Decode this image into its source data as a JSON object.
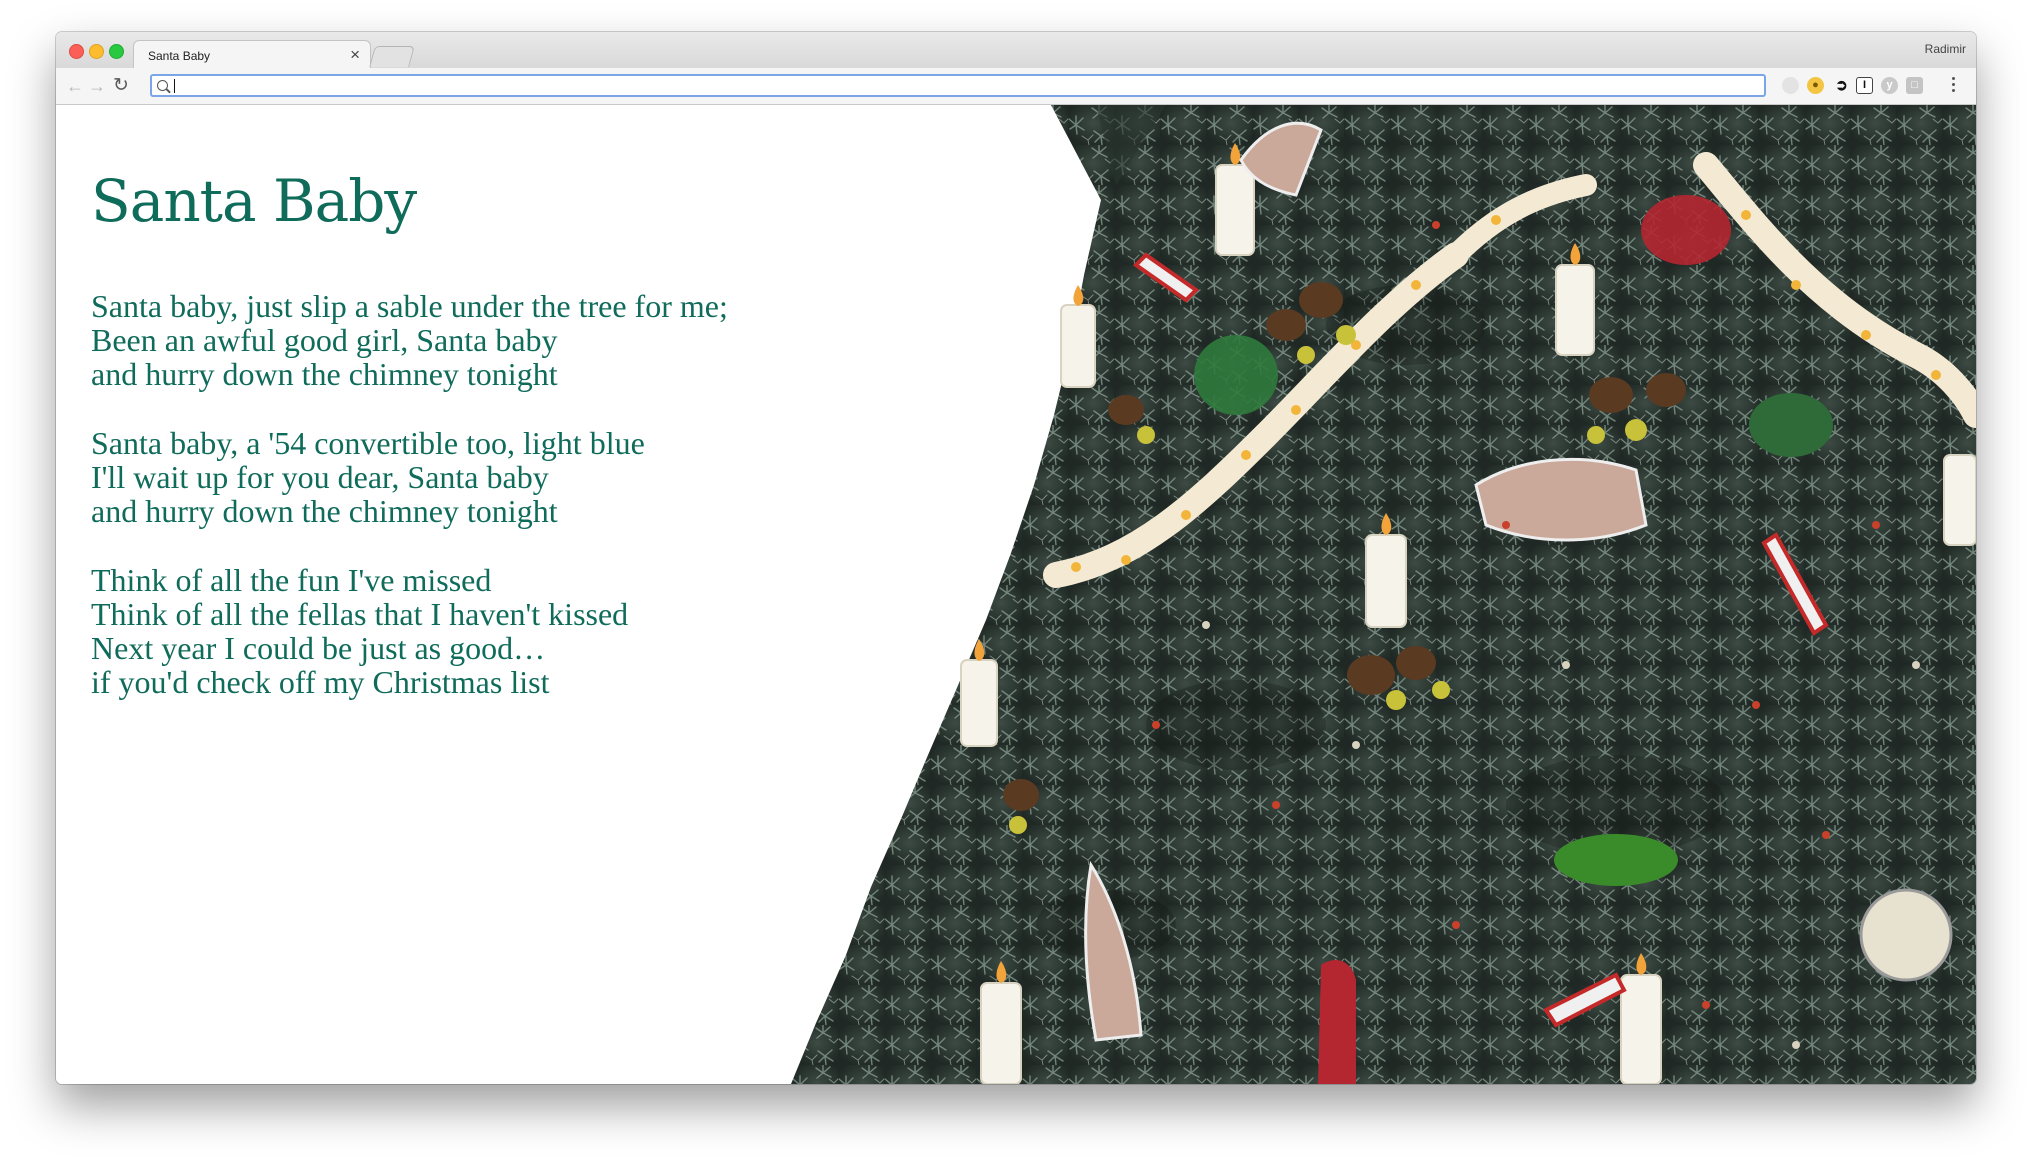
{
  "browser": {
    "tab_title": "Santa Baby",
    "tab_close": "×",
    "profile_name": "Radimir",
    "address_value": "",
    "icons": {
      "back": "back-arrow-icon",
      "forward": "forward-arrow-icon",
      "reload": "reload-icon",
      "search": "search-icon",
      "menu": "kebab-menu-icon"
    },
    "extensions": [
      "extension-circle-icon",
      "extension-coin-icon",
      "extension-cursor-icon",
      "extension-text-cursor-icon",
      "extension-y-icon",
      "extension-square-icon"
    ]
  },
  "page": {
    "title": "Santa Baby",
    "verses": [
      [
        "Santa baby, just slip a sable under the tree for me;",
        "Been an awful good girl, Santa baby",
        "and hurry down the chimney tonight"
      ],
      [
        "Santa baby, a '54 convertible too, light blue",
        "I'll wait up for you dear, Santa baby",
        "and hurry down the chimney tonight"
      ],
      [
        "Think of all the fun I've missed",
        "Think of all the fellas that I haven't kissed",
        "Next year I could be just as good…",
        "if you'd check off my Christmas list"
      ]
    ],
    "text_color": "#0f6b5a",
    "image_subject": "decorated-christmas-tree"
  }
}
